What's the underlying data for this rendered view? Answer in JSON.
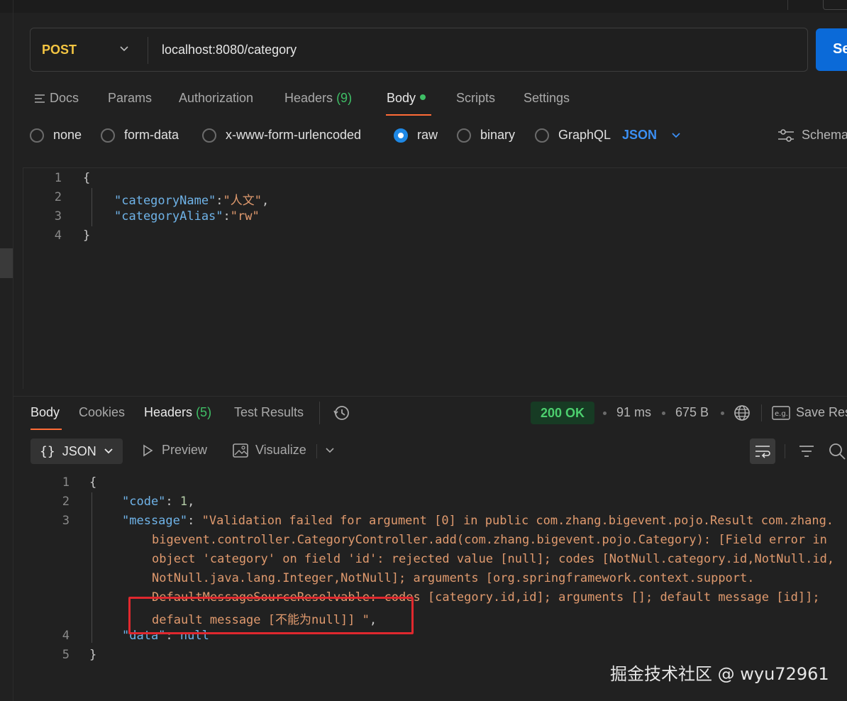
{
  "request": {
    "method": "POST",
    "url": "localhost:8080/category",
    "send_label": "Se"
  },
  "request_tabs": {
    "docs": "Docs",
    "params": "Params",
    "authorization": "Authorization",
    "headers": "Headers",
    "headers_count": "(9)",
    "body": "Body",
    "scripts": "Scripts",
    "settings": "Settings"
  },
  "body_types": {
    "none": "none",
    "form_data": "form-data",
    "urlencoded": "x-www-form-urlencoded",
    "raw": "raw",
    "binary": "binary",
    "graphql": "GraphQL",
    "format": "JSON",
    "schema": "Schema"
  },
  "request_body": {
    "lines": [
      "1",
      "2",
      "3",
      "4"
    ],
    "open": "{",
    "close": "}",
    "key1": "\"categoryName\"",
    "val1": "\"人文\"",
    "key2": "\"categoryAlias\"",
    "val2": "\"rw\""
  },
  "response_tabs": {
    "body": "Body",
    "cookies": "Cookies",
    "headers": "Headers",
    "headers_count": "(5)",
    "test_results": "Test Results"
  },
  "response_meta": {
    "status": "200 OK",
    "time": "91 ms",
    "size": "675 B",
    "save": "Save Res"
  },
  "response_toolbar": {
    "format": "JSON",
    "preview": "Preview",
    "visualize": "Visualize"
  },
  "response_body": {
    "lines": [
      "1",
      "2",
      "3",
      "4",
      "5"
    ],
    "open": "{",
    "close": "}",
    "code_key": "\"code\"",
    "code_val": "1",
    "message_key": "\"message\"",
    "message_l1": "\"Validation failed for argument [0] in public com.zhang.bigevent.pojo.Result com.zhang.",
    "message_l2": "bigevent.controller.CategoryController.add(com.zhang.bigevent.pojo.Category): [Field error in",
    "message_l3": "object 'category' on field 'id': rejected value [null]; codes [NotNull.category.id,NotNull.id,",
    "message_l4": "NotNull.java.lang.Integer,NotNull]; arguments [org.springframework.context.support.",
    "message_l5": "DefaultMessageSourceResolvable: codes [category.id,id]; arguments []; default message [id]];",
    "message_l6": "default message [不能为null]] \"",
    "data_key": "\"data\"",
    "data_val": "null"
  },
  "watermark": "掘金技术社区 @ wyu72961"
}
